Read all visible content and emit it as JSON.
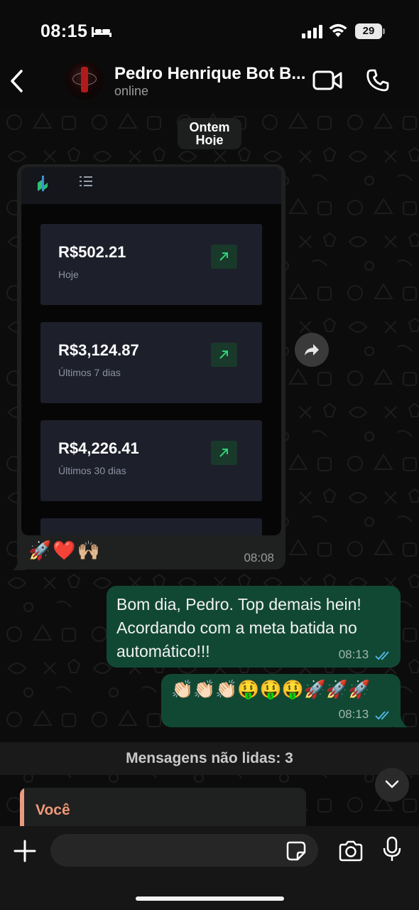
{
  "status_bar": {
    "time": "08:15",
    "battery": "29",
    "sleep_icon": "bed-icon",
    "signal_icon": "cellular-signal-icon",
    "wifi_icon": "wifi-icon"
  },
  "header": {
    "contact_name": "Pedro Henrique Bot B...",
    "status": "online",
    "back_icon": "chevron-left-icon",
    "video_icon": "video-camera-icon",
    "call_icon": "phone-icon"
  },
  "chat": {
    "date_label_top": "Ontem",
    "date_label_bottom": "Hoje",
    "incoming": {
      "screenshot_cards": [
        {
          "value": "R$502.21",
          "label": "Hoje"
        },
        {
          "value": "R$3,124.87",
          "label": "Últimos 7 dias"
        },
        {
          "value": "R$4,226.41",
          "label": "Últimos 30 dias"
        }
      ],
      "trend_icon": "trending-up-arrow-icon",
      "reactions": "🚀❤️🙌🏼",
      "time": "08:08"
    },
    "outgoing": [
      {
        "text": "Bom dia, Pedro. Top demais hein!\nAcordando com a meta batida no\nautomático!!!",
        "time": "08:13",
        "status": "read"
      },
      {
        "text": "👏🏻👏🏻👏🏻🤑🤑🤑🚀🚀🚀",
        "time": "08:13",
        "status": "read"
      }
    ],
    "unread_label": "Mensagens não lidas: 3",
    "reply_preview_name": "Você"
  },
  "input_bar": {
    "placeholder": "",
    "plus_icon": "plus-icon",
    "sticker_icon": "sticker-icon",
    "camera_icon": "camera-icon",
    "mic_icon": "microphone-icon"
  },
  "colors": {
    "outgoing_bubble": "#114834",
    "incoming_bubble": "#1f2020",
    "read_ticks": "#53bdeb",
    "reply_accent": "#f09a78",
    "trend_green": "#2fd27a"
  }
}
